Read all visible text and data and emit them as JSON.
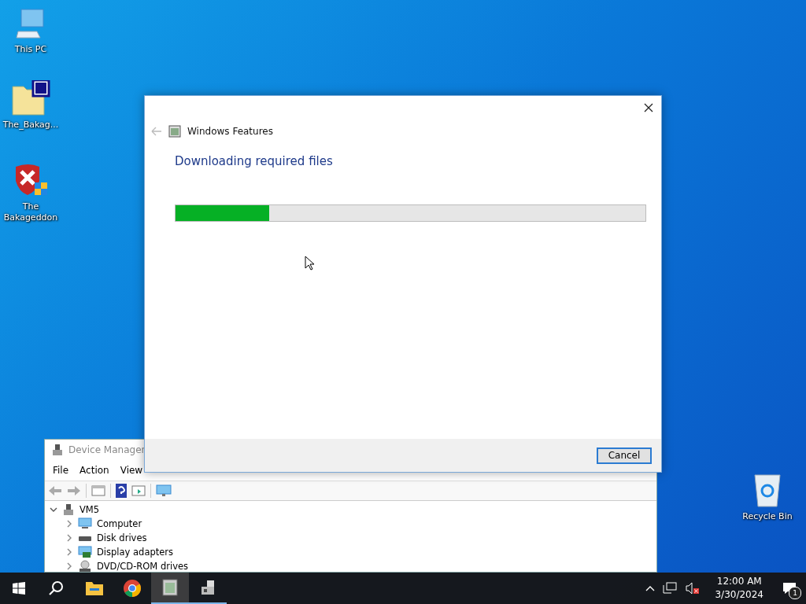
{
  "desktop_icons": [
    {
      "kind": "pc",
      "label": "This PC"
    },
    {
      "kind": "folder",
      "label": "The_Bakag..."
    },
    {
      "kind": "shield",
      "label": "The Bakageddon"
    },
    {
      "kind": "recycle",
      "label": "Recycle Bin"
    }
  ],
  "device_manager": {
    "title": "Device Manager",
    "menu": [
      "File",
      "Action",
      "View"
    ],
    "tree": {
      "label": "VM5",
      "expanded": true,
      "children": [
        {
          "kind": "computer",
          "label": "Computer",
          "expanded": false
        },
        {
          "kind": "disk",
          "label": "Disk drives",
          "expanded": false
        },
        {
          "kind": "display",
          "label": "Display adapters",
          "expanded": false
        },
        {
          "kind": "dvd",
          "label": "DVD/CD-ROM drives",
          "expanded": false
        }
      ]
    }
  },
  "dialog": {
    "title": "Windows Features",
    "heading": "Downloading required files",
    "progress": {
      "level": 0.2
    },
    "buttons": [
      "Cancel"
    ]
  },
  "taskbar": {
    "apps": [
      {
        "kind": "explorer",
        "running": false,
        "selected": false
      },
      {
        "kind": "chrome",
        "running": false,
        "selected": false
      },
      {
        "kind": "features",
        "running": true,
        "selected": true
      },
      {
        "kind": "devmgr",
        "running": true,
        "selected": false
      }
    ],
    "time": "12:00 AM",
    "date": "3/30/2024",
    "notification_count": "1"
  }
}
